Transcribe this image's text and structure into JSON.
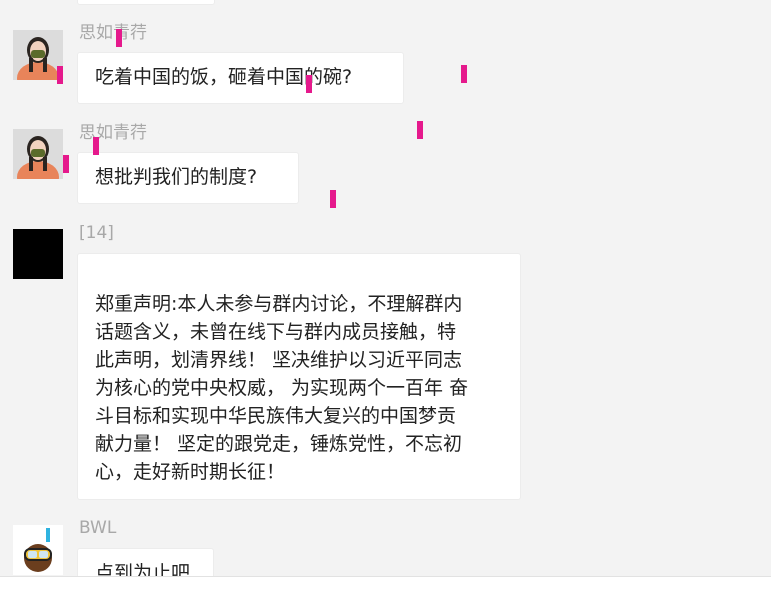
{
  "messages": [
    {
      "sender": "思如青荇",
      "text": "吃着中国的饭，砸着中国的碗?",
      "avatar_icon": "girl-with-mask-avatar"
    },
    {
      "sender": "思如青荇",
      "text": "想批判我们的制度?",
      "avatar_icon": "girl-with-mask-avatar"
    },
    {
      "sender": "[14]",
      "text": "郑重声明:本人未参与群内讨论，不理解群内\n话题含义，未曾在线下与群内成员接触，特\n此声明，划清界线！ 坚决维护以习近平同志\n为核心的党中央权威， 为实现两个一百年 奋\n斗目标和实现中华民族伟大复兴的中国梦贡\n献力量！ 坚定的跟党走，锤炼党性，不忘初\n心，走好新时期长征！",
      "avatar_icon": "black-square-avatar"
    },
    {
      "sender": "BWL",
      "text": "点到为止吧",
      "avatar_icon": "diver-goggles-avatar"
    }
  ],
  "colors": {
    "background": "#f3f3f3",
    "bubble": "#ffffff",
    "sender_name": "#a8a8a8",
    "highlight_mark": "#e5198c"
  }
}
